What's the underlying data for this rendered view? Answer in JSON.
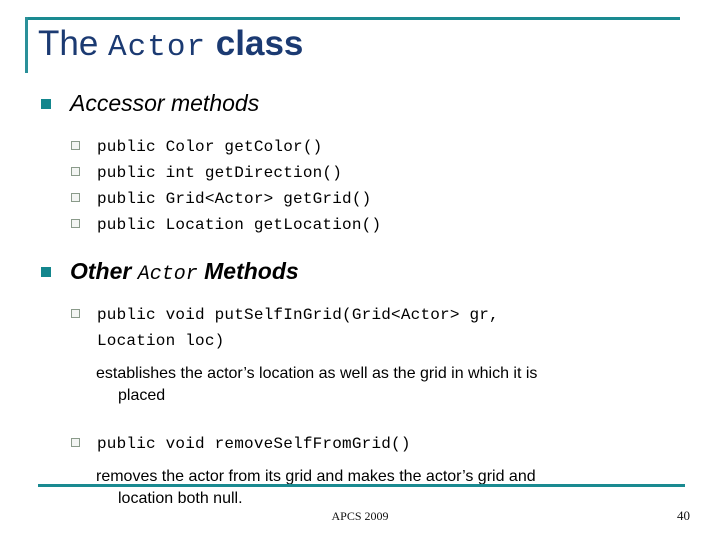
{
  "slide": {
    "title": {
      "part1": "The ",
      "code": "Actor",
      "part2": " class"
    },
    "sections": [
      {
        "heading_plain": "Accessor methods",
        "items": [
          "public Color getColor()",
          "public int getDirection()",
          "public Grid<Actor> getGrid()",
          "public Location getLocation()"
        ]
      },
      {
        "heading_pre": "Other ",
        "heading_code": "Actor",
        "heading_post": " Methods",
        "entry1_code_line1": "public void putSelfInGrid(Grid<Actor> gr,",
        "entry1_code_line2": "Location loc)",
        "entry1_desc_line1": "establishes the actor’s location as well as the grid in which it is",
        "entry1_desc_line2": "placed",
        "entry2_code": "public void removeSelfFromGrid()",
        "entry2_desc_line1": "removes the actor from its grid and makes the actor’s grid and",
        "entry2_desc_line2": "location both null."
      }
    ],
    "footer": {
      "center": "APCS 2009",
      "page_number": "40"
    },
    "colors": {
      "accent_teal": "#1a8a91",
      "title_navy": "#1b3a72",
      "bullet_level1": "#13868d",
      "bullet_level2_border": "#8a9a8a",
      "text": "#000000"
    }
  }
}
